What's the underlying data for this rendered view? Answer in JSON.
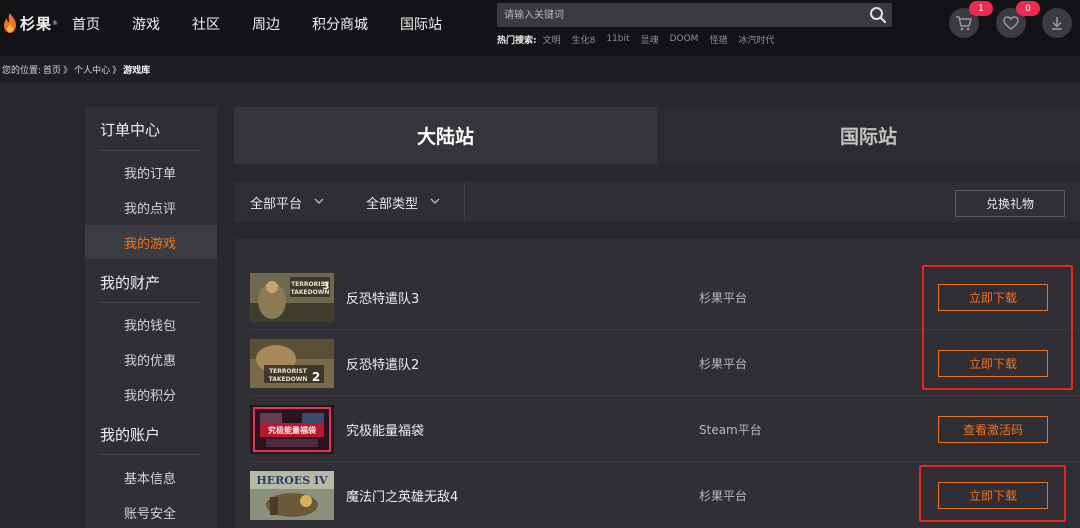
{
  "header": {
    "logo_text": "杉果",
    "logo_mark": "®",
    "nav": [
      "首页",
      "游戏",
      "社区",
      "周边",
      "积分商城",
      "国际站"
    ],
    "search_placeholder": "请输入关键词",
    "hot_label": "热门搜索:",
    "hot_items": [
      "文明",
      "生化8",
      "11bit",
      "显魂",
      "DOOM",
      "怪猎",
      "冰汽时代"
    ],
    "cart_count": "1",
    "wishlist_count": "0",
    "icons": [
      "search-icon",
      "cart-icon",
      "heart-icon",
      "download-icon"
    ]
  },
  "breadcrumb": {
    "prefix": "您的位置:",
    "items": [
      "首页",
      "个人中心",
      "游戏库"
    ],
    "separator": "》"
  },
  "sidebar": {
    "sections": [
      {
        "title": "订单中心",
        "items": [
          "我的订单",
          "我的点评",
          "我的游戏"
        ]
      },
      {
        "title": "我的财产",
        "items": [
          "我的钱包",
          "我的优惠",
          "我的积分"
        ]
      },
      {
        "title": "我的账户",
        "items": [
          "基本信息",
          "账号安全"
        ]
      }
    ],
    "active_item": "我的游戏"
  },
  "tabs": [
    "大陆站",
    "国际站"
  ],
  "active_tab": "大陆站",
  "filters": {
    "platform": "全部平台",
    "type": "全部类型",
    "redeem_label": "兑换礼物"
  },
  "games": [
    {
      "name": "反恐特遣队3",
      "platform": "杉果平台",
      "action": "立即下载",
      "thumb_text": "TERRORIST TAKEDOWN 3"
    },
    {
      "name": "反恐特遣队2",
      "platform": "杉果平台",
      "action": "立即下载",
      "thumb_text": "TERRORIST TAKEDOWN 2"
    },
    {
      "name": "究极能量福袋",
      "platform": "Steam平台",
      "action": "查看激活码",
      "thumb_text": "究极能量福袋"
    },
    {
      "name": "魔法门之英雄无敌4",
      "platform": "杉果平台",
      "action": "立即下载",
      "thumb_text": "HEROES IV"
    }
  ],
  "colors": {
    "accent": "#f0731e",
    "highlight": "#e8281f",
    "badge": "#ee2a52"
  }
}
